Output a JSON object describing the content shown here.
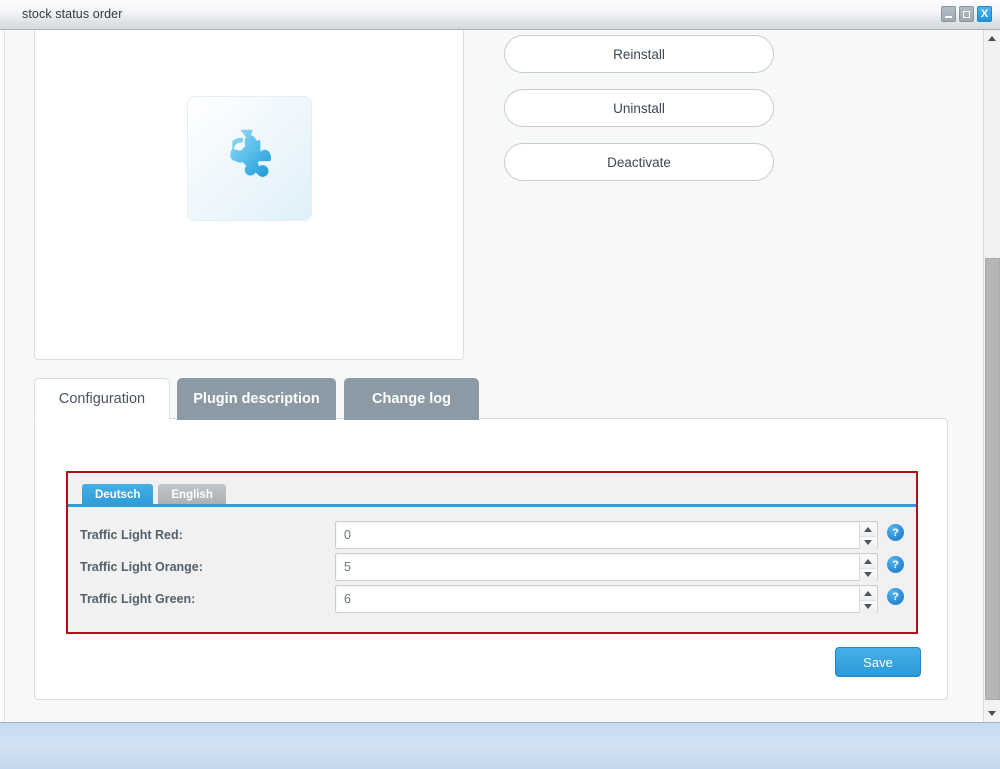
{
  "window": {
    "title": "stock status order",
    "controls": [
      {
        "name": "minimize",
        "glyph": "–"
      },
      {
        "name": "maximize",
        "glyph": "□"
      },
      {
        "name": "close",
        "glyph": "X"
      }
    ]
  },
  "plugin": {
    "icon_name": "puzzle-piece-icon",
    "actions": [
      {
        "label": "Reinstall"
      },
      {
        "label": "Uninstall"
      },
      {
        "label": "Deactivate"
      }
    ]
  },
  "tabs": [
    {
      "label": "Configuration",
      "active": true
    },
    {
      "label": "Plugin description",
      "active": false
    },
    {
      "label": "Change log",
      "active": false
    }
  ],
  "configuration": {
    "languages": [
      {
        "label": "Deutsch",
        "active": true
      },
      {
        "label": "English",
        "active": false
      }
    ],
    "fields": [
      {
        "label": "Traffic Light Red:",
        "value": "0",
        "help": "?"
      },
      {
        "label": "Traffic Light Orange:",
        "value": "5",
        "help": "?"
      },
      {
        "label": "Traffic Light Green:",
        "value": "6",
        "help": "?"
      }
    ],
    "save_label": "Save",
    "validation_border_color": "#b01116"
  },
  "colors": {
    "accent_blue": "#2e9ddb",
    "tab_inactive": "#8b9aa4",
    "error_red": "#b01116",
    "page_bg": "#f7f8f8"
  },
  "scrollbar": {
    "up_arrow": "scroll-up-arrow",
    "down_arrow": "scroll-down-arrow"
  }
}
